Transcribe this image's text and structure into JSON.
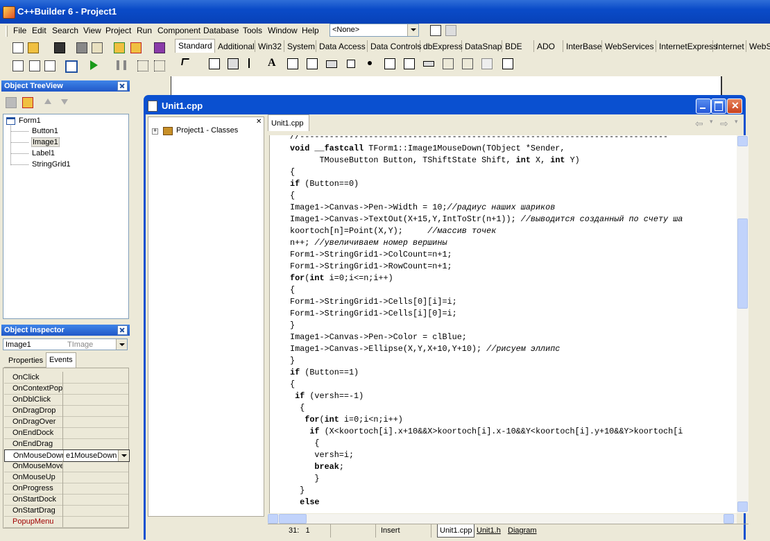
{
  "app": {
    "title": "C++Builder 6 - Project1"
  },
  "menu": [
    "File",
    "Edit",
    "Search",
    "View",
    "Project",
    "Run",
    "Component",
    "Database",
    "Tools",
    "Window",
    "Help"
  ],
  "combo": {
    "value": "<None>"
  },
  "palette_tabs": [
    "Standard",
    "Additional",
    "Win32",
    "System",
    "Data Access",
    "Data Controls",
    "dbExpress",
    "DataSnap",
    "BDE",
    "ADO",
    "InterBase",
    "WebServices",
    "InternetExpress",
    "Internet",
    "WebS"
  ],
  "tree_view": {
    "title": "Object TreeView",
    "root": "Form1",
    "children": [
      "Button1",
      "Image1",
      "Label1",
      "StringGrid1"
    ],
    "selected": "Image1"
  },
  "inspector": {
    "title": "Object Inspector",
    "object_name": "Image1",
    "object_type": "TImage",
    "tabs": [
      "Properties",
      "Events"
    ],
    "active_tab": "Events",
    "events": [
      {
        "name": "OnClick",
        "value": ""
      },
      {
        "name": "OnContextPopu",
        "value": ""
      },
      {
        "name": "OnDblClick",
        "value": ""
      },
      {
        "name": "OnDragDrop",
        "value": ""
      },
      {
        "name": "OnDragOver",
        "value": ""
      },
      {
        "name": "OnEndDock",
        "value": ""
      },
      {
        "name": "OnEndDrag",
        "value": ""
      },
      {
        "name": "OnMouseDowr",
        "value": "e1MouseDown"
      },
      {
        "name": "OnMouseMove",
        "value": ""
      },
      {
        "name": "OnMouseUp",
        "value": ""
      },
      {
        "name": "OnProgress",
        "value": ""
      },
      {
        "name": "OnStartDock",
        "value": ""
      },
      {
        "name": "OnStartDrag",
        "value": ""
      },
      {
        "name": "PopupMenu",
        "value": ""
      }
    ]
  },
  "editor": {
    "title": "Unit1.cpp",
    "tab": "Unit1.cpp",
    "class_root": "Project1 - Classes",
    "code_lines": [
      "//---------------------------------------------------------------------------",
      "void __fastcall TForm1::Image1MouseDown(TObject *Sender,",
      "      TMouseButton Button, TShiftState Shift, int X, int Y)",
      "{",
      "if (Button==0)",
      "{",
      "Image1->Canvas->Pen->Width = 10;//радиус наших шариков",
      "Image1->Canvas->TextOut(X+15,Y,IntToStr(n+1)); //выводится созданный по счету ша",
      "koortoch[n]=Point(X,Y);     //массив точек",
      "n++; //увеличиваем номер вершины",
      "Form1->StringGrid1->ColCount=n+1;",
      "Form1->StringGrid1->RowCount=n+1;",
      "for(int i=0;i<=n;i++)",
      "{",
      "Form1->StringGrid1->Cells[0][i]=i;",
      "Form1->StringGrid1->Cells[i][0]=i;",
      "}",
      "Image1->Canvas->Pen->Color = clBlue;",
      "Image1->Canvas->Ellipse(X,Y,X+10,Y+10); //рисуем эллипс",
      "}",
      "if (Button==1)",
      "{",
      " if (versh==-1)",
      "  {",
      "   for(int i=0;i<n;i++)",
      "    if (X<koortoch[i].x+10&&X>koortoch[i].x-10&&Y<koortoch[i].y+10&&Y>koortoch[i",
      "     {",
      "     versh=i;",
      "     break;",
      "     }",
      "  }",
      "  else"
    ],
    "status": {
      "position": "31:   1",
      "mode": "Insert"
    },
    "bottom_tabs": [
      "Unit1.cpp",
      "Unit1.h",
      "Diagram"
    ]
  }
}
